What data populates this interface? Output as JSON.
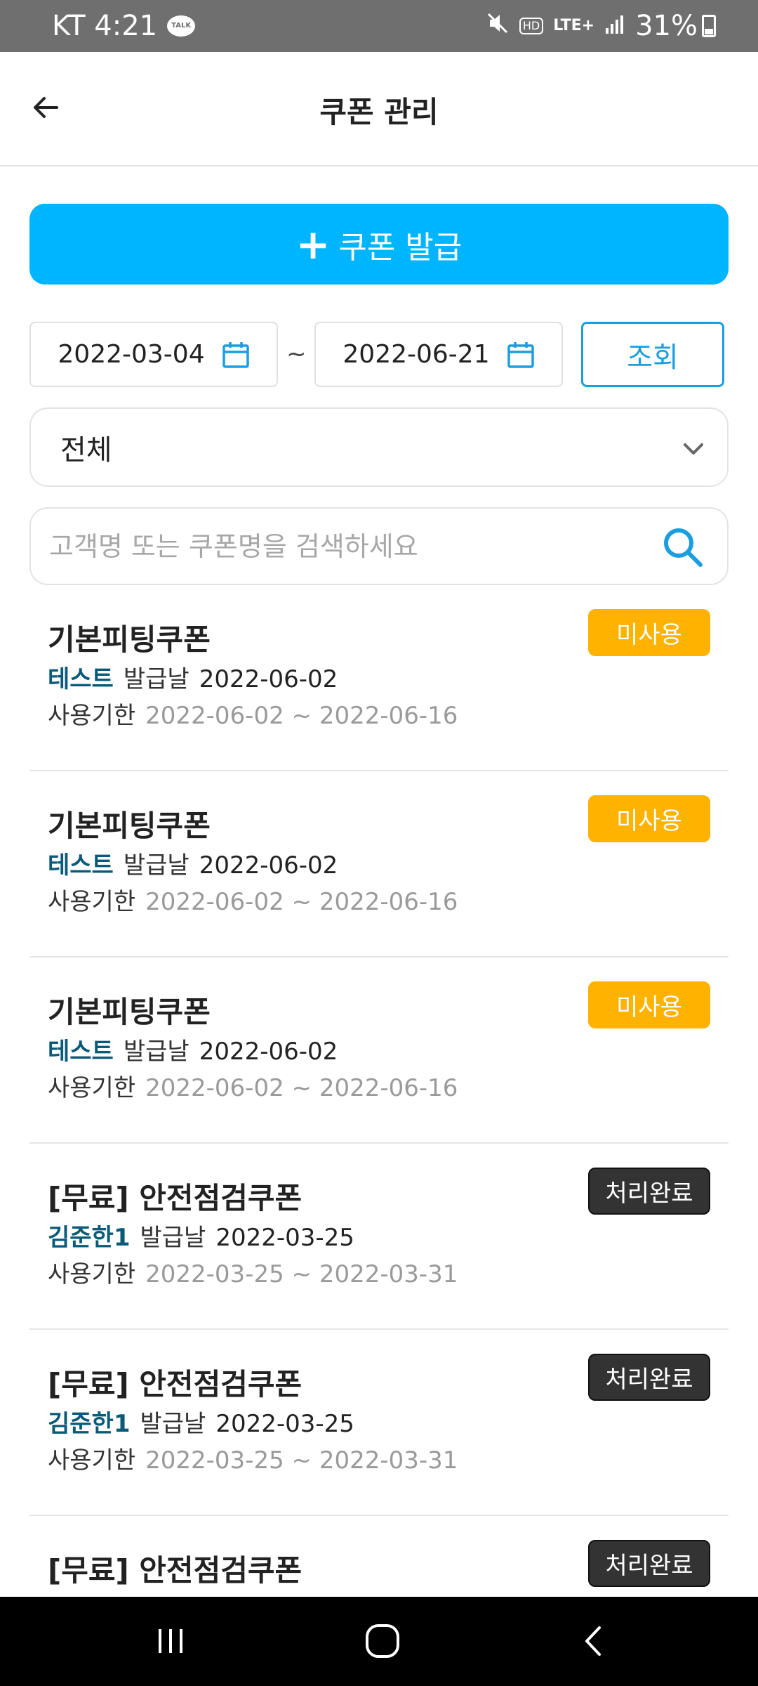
{
  "status_bar": {
    "carrier_time": "KT 4:21",
    "talk_label": "TALK",
    "hd_label": "HD",
    "lte_label": "LTE+",
    "battery_percent": "31%"
  },
  "header": {
    "title": "쿠폰 관리"
  },
  "issue_button": {
    "label": "쿠폰 발급"
  },
  "date_filter": {
    "start_date": "2022-03-04",
    "end_date": "2022-06-21",
    "separator": "~",
    "search_label": "조회"
  },
  "category_dropdown": {
    "selected": "전체"
  },
  "search": {
    "placeholder": "고객명 또는 쿠폰명을 검색하세요"
  },
  "labels": {
    "issued_label": "발급날",
    "validity_label": "사용기한"
  },
  "coupons": [
    {
      "name": "기본피팅쿠폰",
      "customer": "테스트",
      "issued_date": "2022-06-02",
      "period": "2022-06-02 ~ 2022-06-16",
      "status": "미사용"
    },
    {
      "name": "기본피팅쿠폰",
      "customer": "테스트",
      "issued_date": "2022-06-02",
      "period": "2022-06-02 ~ 2022-06-16",
      "status": "미사용"
    },
    {
      "name": "기본피팅쿠폰",
      "customer": "테스트",
      "issued_date": "2022-06-02",
      "period": "2022-06-02 ~ 2022-06-16",
      "status": "미사용"
    },
    {
      "name": "[무료] 안전점검쿠폰",
      "customer": "김준한1",
      "issued_date": "2022-03-25",
      "period": "2022-03-25 ~ 2022-03-31",
      "status": "처리완료"
    },
    {
      "name": "[무료] 안전점검쿠폰",
      "customer": "김준한1",
      "issued_date": "2022-03-25",
      "period": "2022-03-25 ~ 2022-03-31",
      "status": "처리완료"
    },
    {
      "name": "[무료] 안전점검쿠폰",
      "status": "처리완료"
    }
  ],
  "colors": {
    "accent": "#00b5ff",
    "unused_badge": "#ffb300",
    "done_badge": "#333333",
    "customer_name": "#0a5a7a"
  },
  "icons": {
    "back": "arrow-left-icon",
    "plus": "plus-icon",
    "calendar": "calendar-icon",
    "dropdown": "chevron-down-icon",
    "search": "search-icon",
    "nav_recents": "recents-icon",
    "nav_home": "home-icon",
    "nav_back": "chevron-left-icon"
  }
}
